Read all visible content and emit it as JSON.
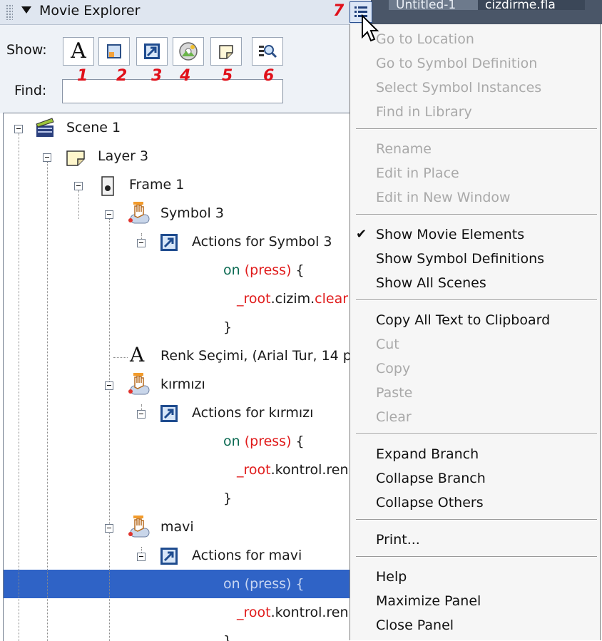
{
  "panel": {
    "title": "Movie Explorer"
  },
  "tabs": [
    {
      "label": "Untitled-1"
    },
    {
      "label": "cizdirme.fla"
    }
  ],
  "toolbar": {
    "show_label": "Show:",
    "find_label": "Find:",
    "find_value": "",
    "filters": [
      {
        "name": "text-filter",
        "icon": "text-A-icon",
        "number": "1"
      },
      {
        "name": "buttons-movieclips-graphics-filter",
        "icon": "symbol-square-icon",
        "number": "2"
      },
      {
        "name": "actionscript-filter",
        "icon": "action-arrow-icon",
        "number": "3"
      },
      {
        "name": "video-sound-bitmap-filter",
        "icon": "media-disc-icon",
        "number": "4"
      },
      {
        "name": "frames-layers-filter",
        "icon": "layer-page-icon",
        "number": "5"
      },
      {
        "name": "customize-filter",
        "icon": "magnifier-list-icon",
        "number": "6"
      }
    ],
    "menu_number": "7"
  },
  "tree": {
    "scene": "Scene 1",
    "layer": "Layer 3",
    "frame": "Frame 1",
    "symbol3": "Symbol 3",
    "actions_symbol3": "Actions for Symbol 3",
    "code_on": "on",
    "code_press": "(press)",
    "code_brace_open": "{",
    "code_root": "_root",
    "code_cizim": ".cizim.",
    "code_clear": "clear",
    "code_brace_close": "}",
    "text_item": "Renk Seçimi, (Arial Tur, 14 p",
    "kirmizi": "kırmızı",
    "actions_kirmizi": "Actions for kırmızı",
    "code_kontrol": ".kontrol.ren",
    "mavi": "mavi",
    "actions_mavi": "Actions for mavi",
    "selected_code": "on (press) {",
    "code_kontrol2": ".kontrol.ren"
  },
  "menu": {
    "items": [
      {
        "label": "Go to Location",
        "enabled": false
      },
      {
        "label": "Go to Symbol Definition",
        "enabled": false
      },
      {
        "label": "Select Symbol Instances",
        "enabled": false
      },
      {
        "label": "Find in Library",
        "enabled": false
      },
      {
        "label": "Rename",
        "enabled": false
      },
      {
        "label": "Edit in Place",
        "enabled": false
      },
      {
        "label": "Edit in New Window",
        "enabled": false
      },
      {
        "label": "Show Movie Elements",
        "enabled": true,
        "checked": true
      },
      {
        "label": "Show Symbol Definitions",
        "enabled": true
      },
      {
        "label": "Show All Scenes",
        "enabled": true
      },
      {
        "label": "Copy All Text to Clipboard",
        "enabled": true
      },
      {
        "label": "Cut",
        "enabled": false
      },
      {
        "label": "Copy",
        "enabled": false
      },
      {
        "label": "Paste",
        "enabled": false
      },
      {
        "label": "Clear",
        "enabled": false
      },
      {
        "label": "Expand Branch",
        "enabled": true
      },
      {
        "label": "Collapse Branch",
        "enabled": true
      },
      {
        "label": "Collapse Others",
        "enabled": true
      },
      {
        "label": "Print...",
        "enabled": true
      },
      {
        "label": "Help",
        "enabled": true
      },
      {
        "label": "Maximize Panel",
        "enabled": true
      },
      {
        "label": "Close Panel",
        "enabled": true
      }
    ]
  },
  "colors": {
    "selection": "#2f63c6",
    "keyword": "#0b6a52",
    "red": "#e01b1b",
    "annotation": "#e0101a"
  }
}
